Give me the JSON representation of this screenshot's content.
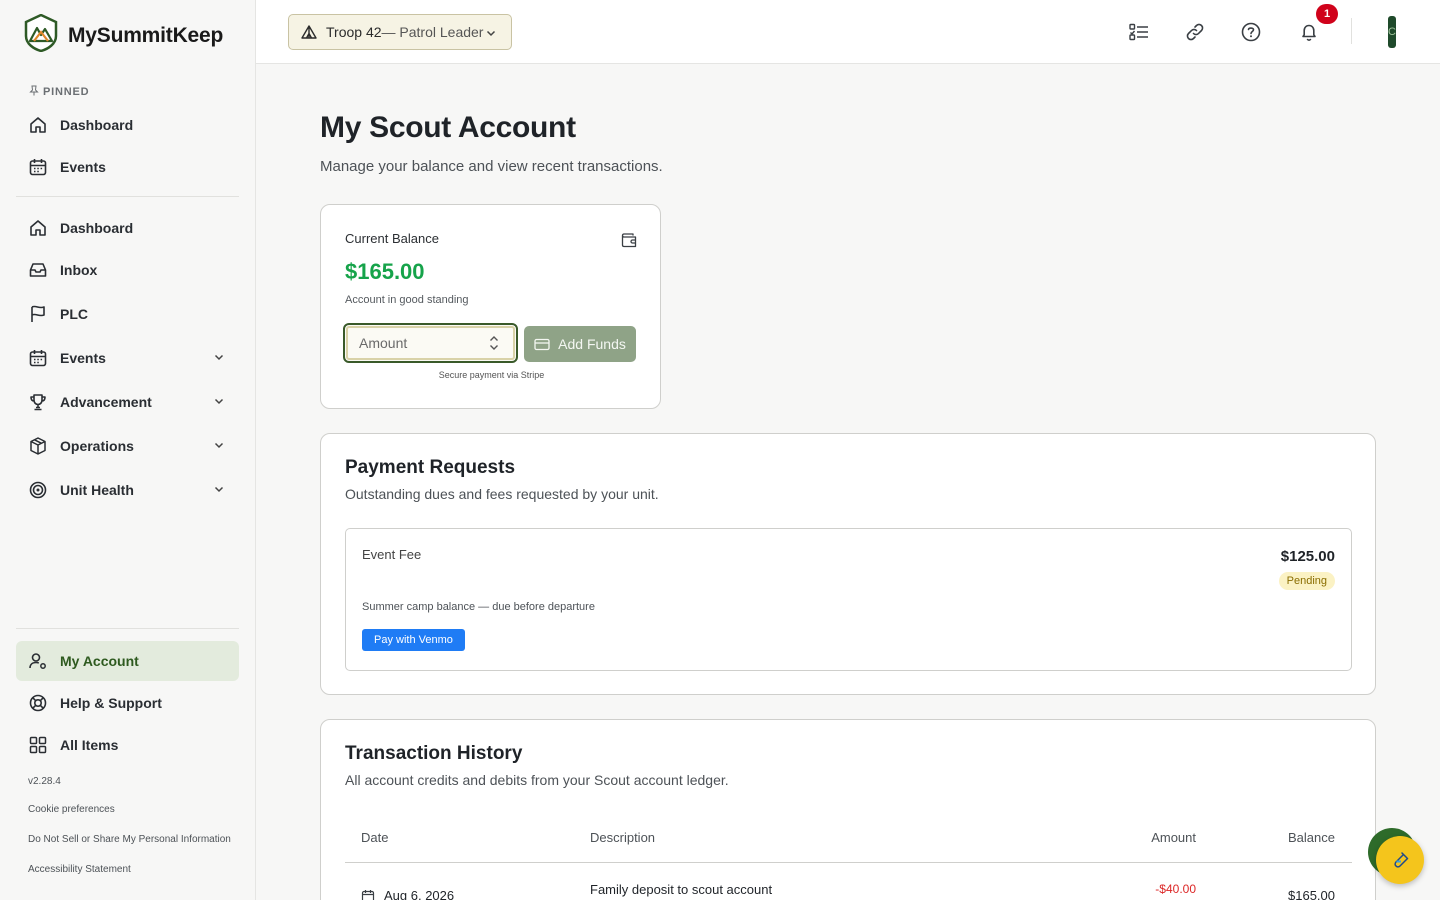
{
  "app": {
    "name": "MySummitKeep"
  },
  "sidebar": {
    "pinned_label": "PINNED",
    "pinned": [
      {
        "label": "Dashboard",
        "icon": "home-icon"
      },
      {
        "label": "Events",
        "icon": "calendar-icon"
      }
    ],
    "items": [
      {
        "label": "Dashboard",
        "icon": "home-icon"
      },
      {
        "label": "Inbox",
        "icon": "inbox-icon"
      },
      {
        "label": "PLC",
        "icon": "flag-icon"
      },
      {
        "label": "Events",
        "icon": "calendar-icon"
      },
      {
        "label": "Advancement",
        "icon": "trophy-icon"
      },
      {
        "label": "Operations",
        "icon": "box-icon"
      },
      {
        "label": "Unit Health",
        "icon": "target-icon"
      }
    ],
    "bottom": [
      {
        "label": "My Account",
        "icon": "user-gear-icon"
      },
      {
        "label": "Help & Support",
        "icon": "lifebuoy-icon"
      },
      {
        "label": "All Items",
        "icon": "grid-icon"
      }
    ],
    "version": "v2.28.4",
    "links": [
      "Cookie preferences",
      "Do Not Sell or Share My Personal Information",
      "Accessibility Statement"
    ]
  },
  "topbar": {
    "troop": "Troop 42",
    "role": " — Patrol Leader",
    "notification_count": "1",
    "avatar_initial": "C"
  },
  "page": {
    "title": "My Scout Account",
    "subtitle": "Manage your balance and view recent transactions."
  },
  "balance": {
    "label": "Current Balance",
    "amount": "$165.00",
    "status": "Account in good standing",
    "amount_placeholder": "Amount",
    "add_funds": "Add Funds",
    "secure_note": "Secure payment via Stripe"
  },
  "payment_requests": {
    "title": "Payment Requests",
    "subtitle": "Outstanding dues and fees requested by your unit.",
    "items": [
      {
        "type": "Event Fee",
        "amount": "$125.00",
        "status": "Pending",
        "description": "Summer camp balance — due before departure",
        "action": "Pay with Venmo"
      }
    ]
  },
  "transactions": {
    "title": "Transaction History",
    "subtitle": "All account credits and debits from your Scout account ledger.",
    "columns": [
      "Date",
      "Description",
      "Amount",
      "Balance"
    ],
    "rows": [
      {
        "date": "Aug 6, 2026",
        "description": "Family deposit to scout account",
        "amount": "-$40.00",
        "balance": "$165.00"
      }
    ]
  },
  "colors": {
    "brand_green": "#2e6b2a",
    "balance_green": "#16a34a",
    "negative": "#dc2626",
    "venmo": "#1f7cf5",
    "pending": "#fbf2c4"
  }
}
